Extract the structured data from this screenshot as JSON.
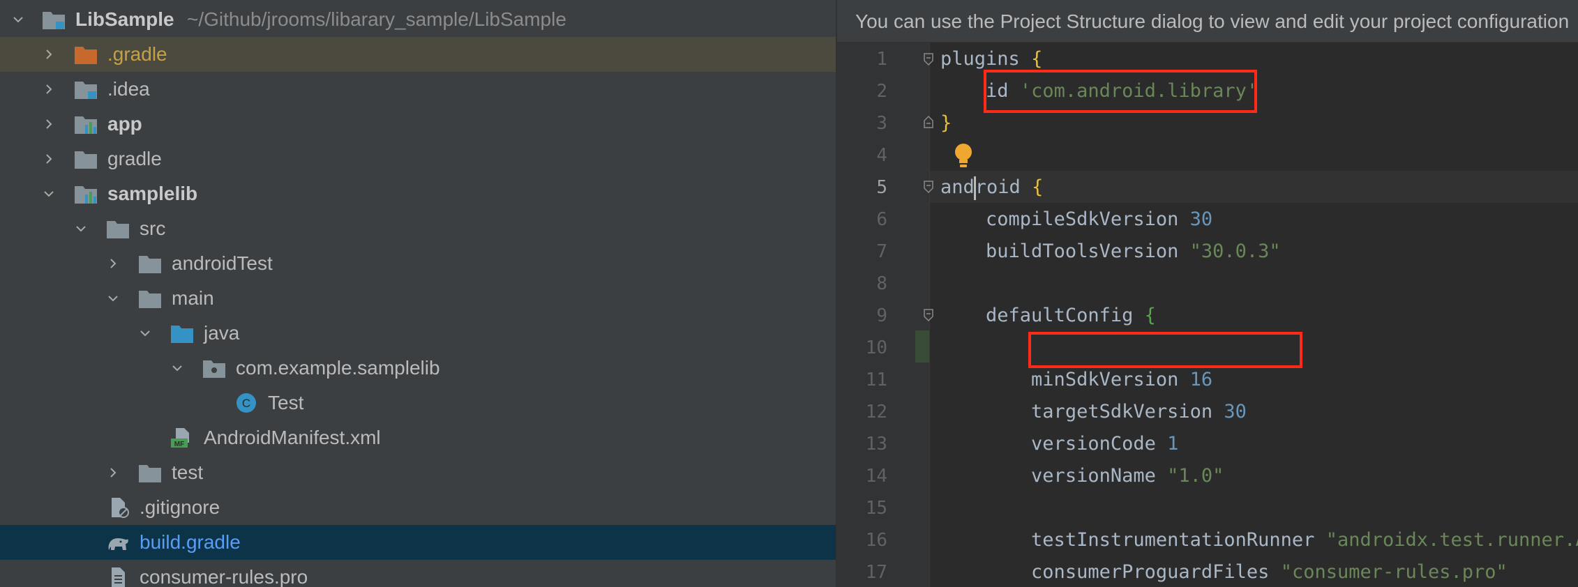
{
  "tree": {
    "root": {
      "name": "LibSample",
      "path": "~/Github/jrooms/libarary_sample/LibSample"
    },
    "items": [
      {
        "label": ".gradle"
      },
      {
        "label": ".idea"
      },
      {
        "label": "app"
      },
      {
        "label": "gradle"
      },
      {
        "label": "samplelib"
      },
      {
        "label": "src"
      },
      {
        "label": "androidTest"
      },
      {
        "label": "main"
      },
      {
        "label": "java"
      },
      {
        "label": "com.example.samplelib"
      },
      {
        "label": "Test"
      },
      {
        "label": "AndroidManifest.xml"
      },
      {
        "label": "test"
      },
      {
        "label": ".gitignore"
      },
      {
        "label": "build.gradle"
      },
      {
        "label": "consumer-rules.pro"
      }
    ]
  },
  "editor": {
    "banner": "You can use the Project Structure dialog to view and edit your project configuration",
    "line_numbers": [
      "1",
      "2",
      "3",
      "4",
      "5",
      "6",
      "7",
      "8",
      "9",
      "10",
      "11",
      "12",
      "13",
      "14",
      "15",
      "16",
      "17"
    ],
    "code": {
      "l1_kw": "plugins",
      "l1_brace": "{",
      "l2_kw": "id",
      "l2_str": "'com.android.library'",
      "l3_brace": "}",
      "l5_kw_a": "and",
      "l5_kw_b": "roid",
      "l5_brace": "{",
      "l6_kw": "compileSdkVersion",
      "l6_num": "30",
      "l7_kw": "buildToolsVersion",
      "l7_str": "\"30.0.3\"",
      "l9_kw": "defaultConfig",
      "l9_brace": "{",
      "l11_kw": "minSdkVersion",
      "l11_num": "16",
      "l12_kw": "targetSdkVersion",
      "l12_num": "30",
      "l13_kw": "versionCode",
      "l13_num": "1",
      "l14_kw": "versionName",
      "l14_str": "\"1.0\"",
      "l16_kw": "testInstrumentationRunner",
      "l16_str": "\"androidx.test.runner.AndroidJUnitRunner\"",
      "l17_kw": "consumerProguardFiles",
      "l17_str": "\"consumer-rules.pro\""
    },
    "highlight_color": "#ff2a17"
  }
}
